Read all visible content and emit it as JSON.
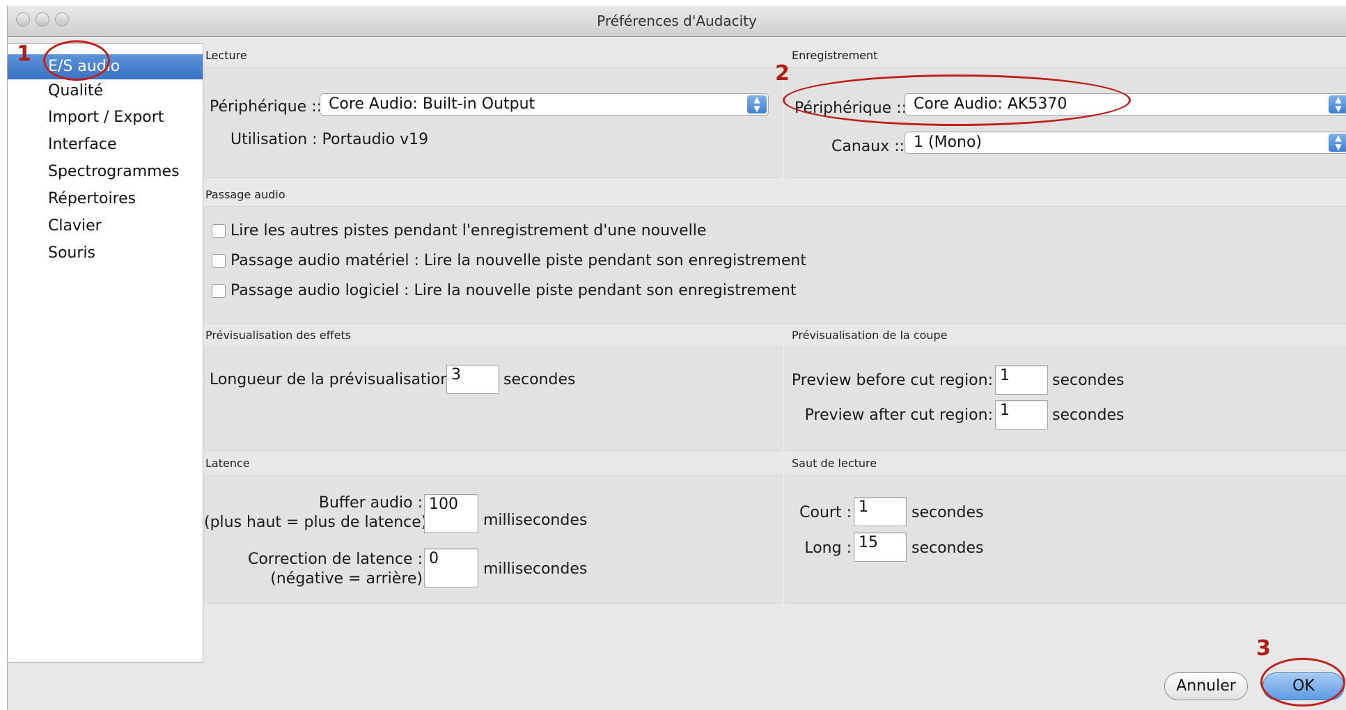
{
  "window": {
    "title": "Préférences d'Audacity"
  },
  "sidebar": {
    "items": [
      {
        "label": "E/S audio",
        "selected": true
      },
      {
        "label": "Qualité"
      },
      {
        "label": "Import / Export"
      },
      {
        "label": "Interface"
      },
      {
        "label": "Spectrogrammes"
      },
      {
        "label": "Répertoires"
      },
      {
        "label": "Clavier"
      },
      {
        "label": "Souris"
      }
    ]
  },
  "lecture": {
    "title": "Lecture",
    "device_label": "Périphérique ::",
    "device_value": "Core Audio: Built-in Output",
    "usage": "Utilisation : Portaudio v19"
  },
  "enregistrement": {
    "title": "Enregistrement",
    "device_label": "Périphérique ::",
    "device_value": "Core Audio: AK5370",
    "channels_label": "Canaux ::",
    "channels_value": "1 (Mono)"
  },
  "passage": {
    "title": "Passage audio",
    "options": [
      "Lire les autres pistes pendant l'enregistrement d'une nouvelle",
      "Passage audio matériel : Lire la nouvelle piste pendant son enregistrement",
      "Passage audio logiciel : Lire la nouvelle piste pendant son enregistrement"
    ]
  },
  "preview_effects": {
    "title": "Prévisualisation des effets",
    "length_label": "Longueur de la prévisualisation :",
    "length_value": "3",
    "unit": "secondes"
  },
  "preview_cut": {
    "title": "Prévisualisation de la coupe",
    "before_label": "Preview before cut region:",
    "before_value": "1",
    "after_label": "Preview after cut region:",
    "after_value": "1",
    "unit": "secondes"
  },
  "latence": {
    "title": "Latence",
    "buffer_label_1": "Buffer audio :",
    "buffer_label_2": "(plus haut = plus de latence)",
    "buffer_value": "100",
    "correction_label_1": "Correction de latence :",
    "correction_label_2": "(négative = arrière)",
    "correction_value": "0",
    "unit": "millisecondes"
  },
  "saut": {
    "title": "Saut de lecture",
    "short_label": "Court :",
    "short_value": "1",
    "long_label": "Long :",
    "long_value": "15",
    "unit": "secondes"
  },
  "buttons": {
    "cancel": "Annuler",
    "ok": "OK"
  },
  "annotations": {
    "n1": "1",
    "n2": "2",
    "n3": "3",
    "color": "#c0201a"
  }
}
